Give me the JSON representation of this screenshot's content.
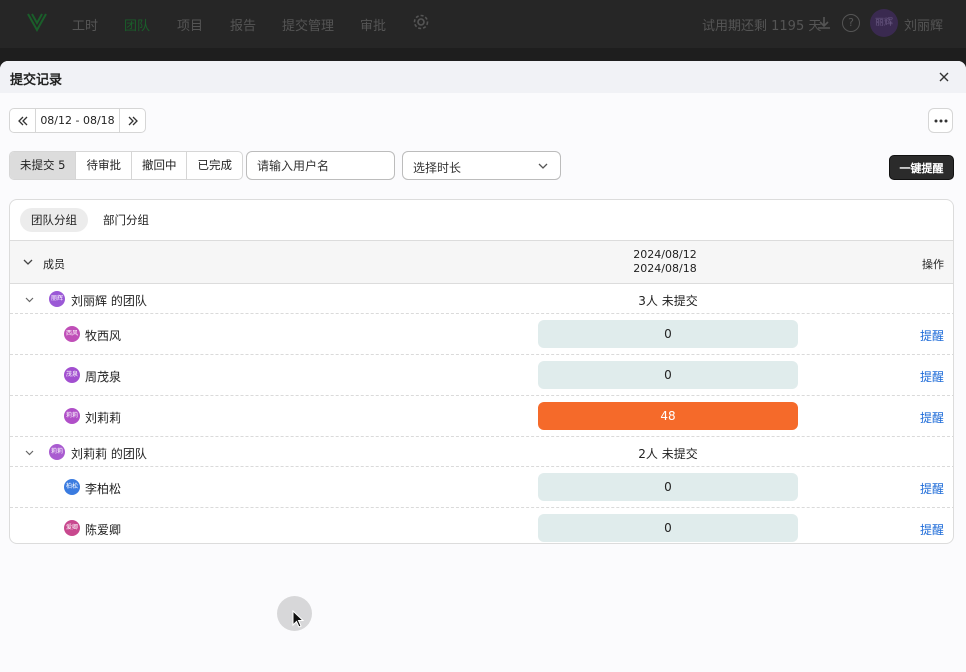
{
  "nav": {
    "items": [
      "工时",
      "团队",
      "项目",
      "报告",
      "提交管理",
      "审批"
    ],
    "active": "团队",
    "trial_text": "试用期还剩 1195 天",
    "user_name": "刘丽辉",
    "avatar_text": "丽辉"
  },
  "modal": {
    "title": "提交记录",
    "date_range": "08/12 - 08/18",
    "status_tabs": [
      "未提交 5",
      "待审批",
      "撤回中",
      "已完成"
    ],
    "search_placeholder": "请输入用户名",
    "duration_placeholder": "选择时长",
    "remind_all": "一键提醒"
  },
  "table": {
    "group_tabs": [
      "团队分组",
      "部门分组"
    ],
    "headers": {
      "member": "成员",
      "date_start": "2024/08/12",
      "date_end": "2024/08/18",
      "op": "操作"
    },
    "remind_label": "提醒",
    "groups": [
      {
        "name": "刘丽辉 的团队",
        "avatar": "丽辉",
        "avatar_color": "#9b59d6",
        "summary": "3人 未提交",
        "members": [
          {
            "name": "牧西风",
            "avatar": "西风",
            "avatar_color": "#c04fb8",
            "count": "0",
            "hot": false
          },
          {
            "name": "周茂泉",
            "avatar": "茂泉",
            "avatar_color": "#a24fd0",
            "count": "0",
            "hot": false
          },
          {
            "name": "刘莉莉",
            "avatar": "莉莉",
            "avatar_color": "#b04fc8",
            "count": "48",
            "hot": true
          }
        ]
      },
      {
        "name": "刘莉莉 的团队",
        "avatar": "莉莉",
        "avatar_color": "#a95bd0",
        "summary": "2人 未提交",
        "members": [
          {
            "name": "李柏松",
            "avatar": "柏松",
            "avatar_color": "#3a7be0",
            "count": "0",
            "hot": false
          },
          {
            "name": "陈爱卿",
            "avatar": "爱卿",
            "avatar_color": "#c8488e",
            "count": "0",
            "hot": false
          }
        ]
      }
    ]
  }
}
